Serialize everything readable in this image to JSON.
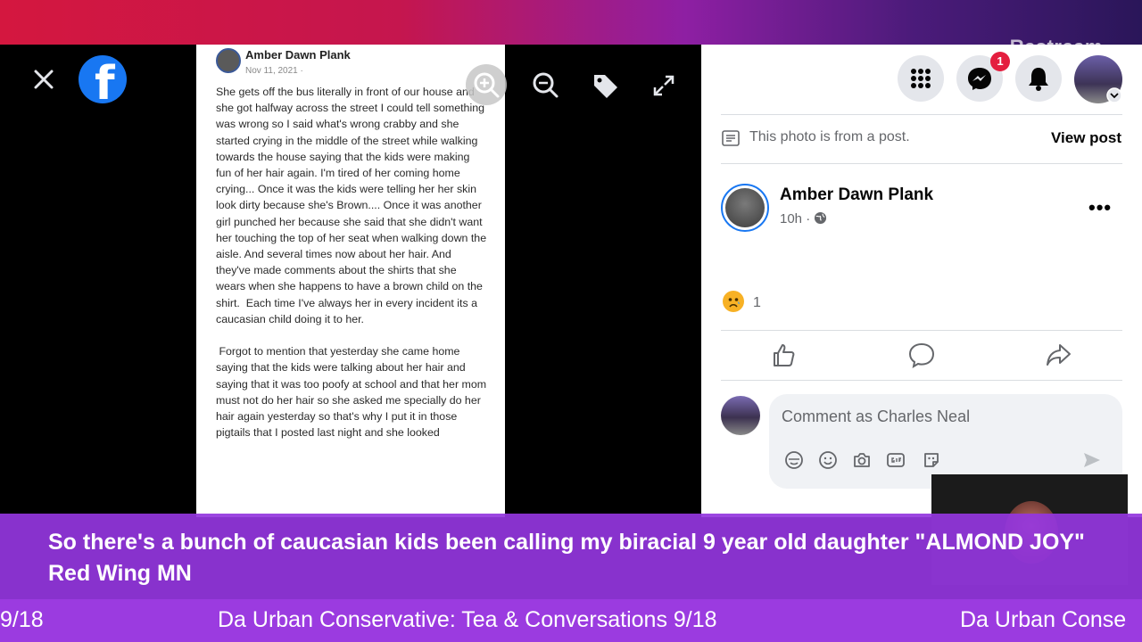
{
  "overlay": {
    "watermark": "Restream"
  },
  "viewer": {
    "close_label": "close",
    "logo_letter": "f",
    "post_image": {
      "author": "Amber Dawn Plank",
      "date": "Nov 11, 2021 ·",
      "body": "She gets off the bus literally in front of our house and she got halfway across the street I could tell something was wrong so I said what's wrong crabby and she started crying in the middle of the street while walking towards the house saying that the kids were making fun of her hair again. I'm tired of her coming home crying... Once it was the kids were telling her her skin look dirty because she's Brown.... Once it was another girl punched her because she said that she didn't want her touching the top of her seat when walking down the aisle. And several times now about her hair. And they've made comments about the shirts that she wears when she happens to have a brown child on the shirt.  Each time I've always her in every incident its a caucasian child doing it to her.\n\n Forgot to mention that yesterday she came home saying that the kids were talking about her hair and saying that it was too poofy at school and that her mom must not do her hair so she asked me specially do her hair again yesterday so that's why I put it in those pigtails that I posted last night and she looked"
    }
  },
  "panel": {
    "notification_badge": "1",
    "photo_note": "This photo is from a post.",
    "view_post": "View post",
    "author": "Amber Dawn Plank",
    "time": "10h ·",
    "more": "•••",
    "reaction_count": "1",
    "comment_placeholder": "Comment as Charles Neal"
  },
  "banner": {
    "headline": "So there's a bunch of caucasian kids been calling my biracial 9 year old daughter \"ALMOND JOY\"  Red Wing MN"
  },
  "ticker": {
    "left": "9/18",
    "center": "Da Urban Conservative: Tea & Conversations 9/18",
    "right": "Da Urban Conse"
  },
  "colors": {
    "facebook_blue": "#1877f2",
    "banner_purple": "#9436de",
    "badge_red": "#e41e3f"
  }
}
